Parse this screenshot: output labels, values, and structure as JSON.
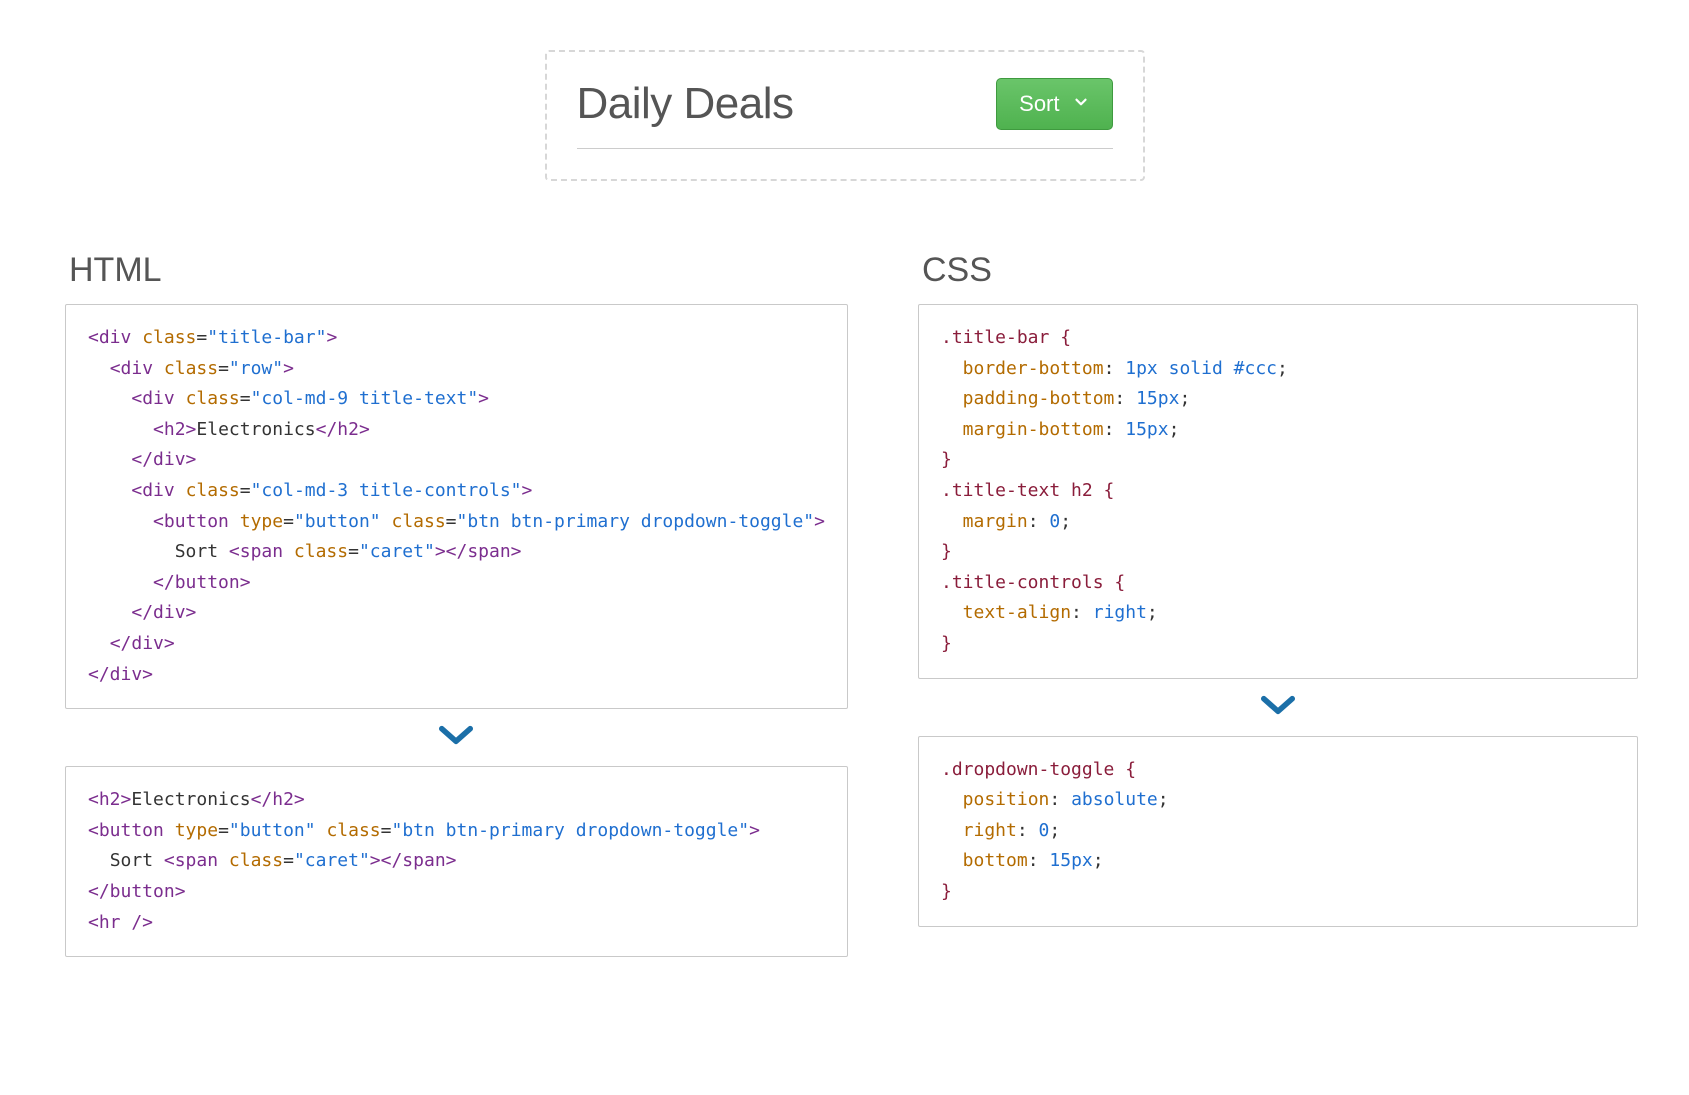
{
  "example": {
    "title": "Daily Deals",
    "button_label": "Sort"
  },
  "columns": {
    "html_heading": "HTML",
    "css_heading": "CSS"
  },
  "code": {
    "html_before": {
      "l1a": "<div",
      "l1b": "class",
      "l1c": "\"title-bar\"",
      "l1d": ">",
      "l2a": "<div",
      "l2b": "class",
      "l2c": "\"row\"",
      "l2d": ">",
      "l3a": "<div",
      "l3b": "class",
      "l3c": "\"col-md-9 title-text\"",
      "l3d": ">",
      "l4a": "<h2>",
      "l4b": "Electronics",
      "l4c": "</h2>",
      "l5a": "</div>",
      "l6a": "<div",
      "l6b": "class",
      "l6c": "\"col-md-3 title-controls\"",
      "l6d": ">",
      "l7a": "<button",
      "l7b": "type",
      "l7c": "\"button\"",
      "l7d": "class",
      "l7e": "\"btn btn-primary dropdown-toggle\"",
      "l7f": ">",
      "l8a": "Sort ",
      "l8b": "<span",
      "l8c": "class",
      "l8d": "\"caret\"",
      "l8e": "></span>",
      "l9a": "</button>",
      "l10a": "</div>",
      "l11a": "</div>",
      "l12a": "</div>"
    },
    "html_after": {
      "l1a": "<h2>",
      "l1b": "Electronics",
      "l1c": "</h2>",
      "l2a": "<button",
      "l2b": "type",
      "l2c": "\"button\"",
      "l2d": "class",
      "l2e": "\"btn btn-primary dropdown-toggle\"",
      "l2f": ">",
      "l3a": "Sort ",
      "l3b": "<span",
      "l3c": "class",
      "l3d": "\"caret\"",
      "l3e": "></span>",
      "l4a": "</button>",
      "l5a": "<hr />"
    },
    "css_before": {
      "s1": ".title-bar {",
      "p1a": "border-bottom",
      "p1b": "1px",
      "p1c": "solid",
      "p1d": "#ccc",
      "p2a": "padding-bottom",
      "p2b": "15px",
      "p3a": "margin-bottom",
      "p3b": "15px",
      "e1": "}",
      "s2": ".title-text h2 {",
      "p4a": "margin",
      "p4b": "0",
      "e2": "}",
      "s3": ".title-controls {",
      "p5a": "text-align",
      "p5b": "right",
      "e3": "}"
    },
    "css_after": {
      "s1": ".dropdown-toggle {",
      "p1a": "position",
      "p1b": "absolute",
      "p2a": "right",
      "p2b": "0",
      "p3a": "bottom",
      "p3b": "15px",
      "e1": "}"
    }
  }
}
